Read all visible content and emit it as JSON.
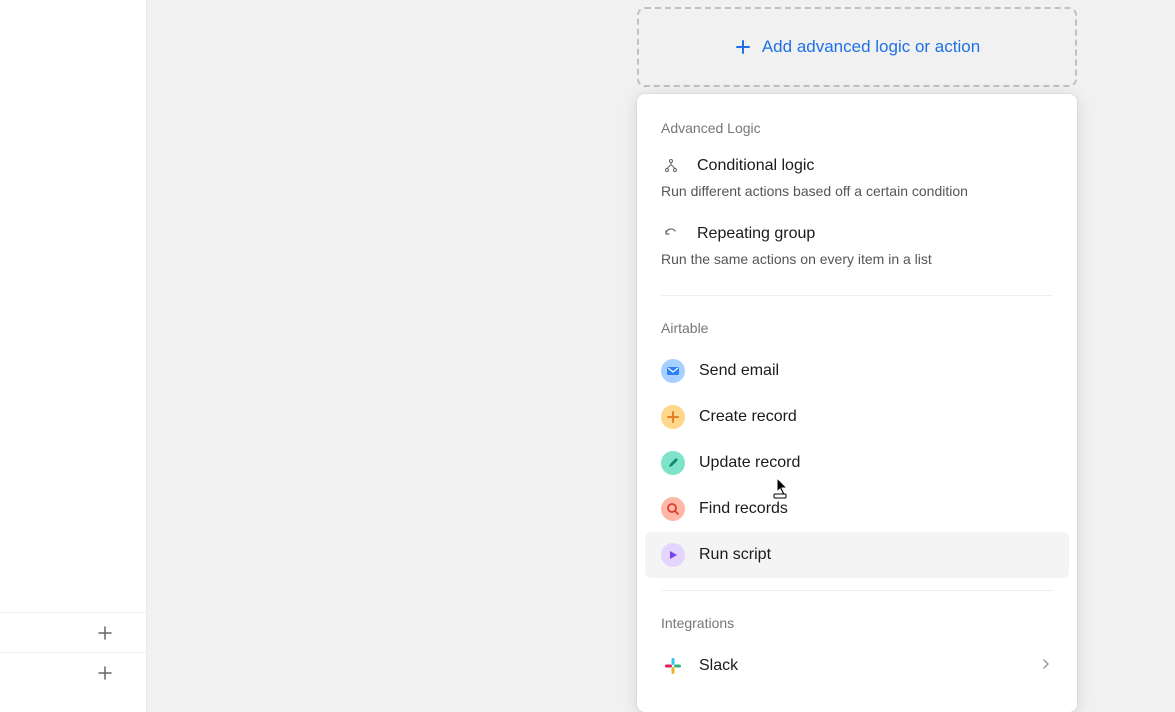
{
  "add_button": {
    "label": "Add advanced logic or action"
  },
  "dropdown": {
    "sections": {
      "advanced_logic": {
        "header": "Advanced Logic",
        "items": [
          {
            "title": "Conditional logic",
            "desc": "Run different actions based off a certain condition",
            "icon": "branch-icon"
          },
          {
            "title": "Repeating group",
            "desc": "Run the same actions on every item in a list",
            "icon": "refresh-icon"
          }
        ]
      },
      "airtable": {
        "header": "Airtable",
        "items": [
          {
            "label": "Send email",
            "icon": "email-icon",
            "icon_class": "icon-email"
          },
          {
            "label": "Create record",
            "icon": "plus-record-icon",
            "icon_class": "icon-create"
          },
          {
            "label": "Update record",
            "icon": "pencil-icon",
            "icon_class": "icon-update"
          },
          {
            "label": "Find records",
            "icon": "search-icon",
            "icon_class": "icon-find"
          },
          {
            "label": "Run script",
            "icon": "play-icon",
            "icon_class": "icon-script",
            "hovered": true
          }
        ]
      },
      "integrations": {
        "header": "Integrations",
        "items": [
          {
            "label": "Slack",
            "icon": "slack-icon"
          }
        ]
      }
    }
  }
}
